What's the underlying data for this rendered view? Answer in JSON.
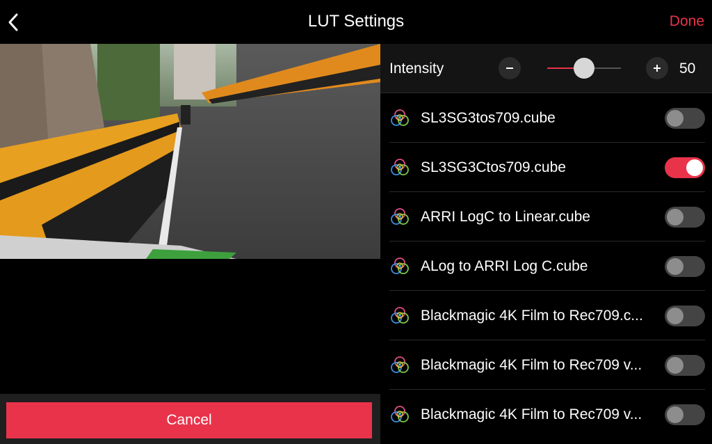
{
  "header": {
    "title": "LUT Settings",
    "back_icon": "chevron-left-icon",
    "done_label": "Done"
  },
  "preview": {
    "description_icon": "video-preview"
  },
  "cancel_label": "Cancel",
  "intensity": {
    "label": "Intensity",
    "value": "50",
    "level": 0.5,
    "minus_icon": "minus-icon",
    "plus_icon": "plus-icon"
  },
  "luts": [
    {
      "name": "SL3SG3tos709.cube",
      "enabled": false
    },
    {
      "name": "SL3SG3Ctos709.cube",
      "enabled": true
    },
    {
      "name": "ARRI LogC to Linear.cube",
      "enabled": false
    },
    {
      "name": "ALog to ARRI Log C.cube",
      "enabled": false
    },
    {
      "name": "Blackmagic 4K Film to Rec709.c...",
      "enabled": false
    },
    {
      "name": "Blackmagic 4K Film to Rec709 v...",
      "enabled": false
    },
    {
      "name": "Blackmagic 4K Film to Rec709 v...",
      "enabled": false
    }
  ],
  "colors": {
    "accent": "#e8334a",
    "background": "#000000",
    "panel": "#141414"
  }
}
